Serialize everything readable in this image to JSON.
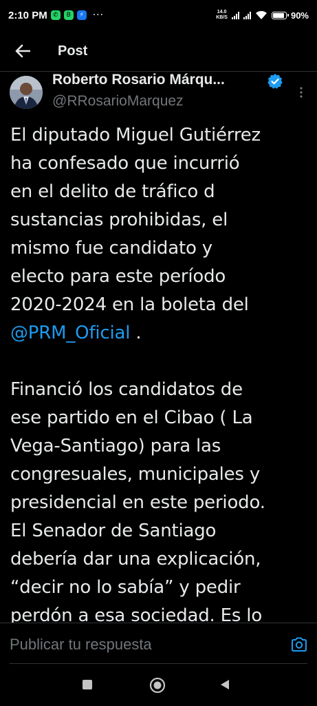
{
  "status_bar": {
    "time": "2:10 PM",
    "more_indicator": "···",
    "net_speed_value": "14.0",
    "net_speed_unit": "KB/S",
    "battery_percent": "90%",
    "battery_level": 0.9
  },
  "header": {
    "title": "Post"
  },
  "author": {
    "name": "Roberto Rosario Márqu...",
    "handle": "@RRosarioMarquez",
    "verified": true
  },
  "tweet": {
    "lines": [
      "El diputado Miguel Gutiérrez",
      "ha confesado que incurrió",
      "en el delito de tráfico d",
      "sustancias prohibidas, el",
      "mismo fue candidato y",
      "electo para este período",
      "2020-2024 en la boleta del"
    ],
    "mention": "@PRM_Oficial",
    "mention_suffix": " .",
    "lines2": [
      "Financió los candidatos de",
      "ese partido en el Cibao ( La",
      "Vega-Santiago) para las",
      "congresuales, municipales y",
      "presidencial en este periodo.",
      "El Senador de Santiago",
      "debería dar una explicación,",
      "“decir no lo sabía” y pedir",
      "perdón a esa sociedad. Es lo"
    ]
  },
  "reply": {
    "placeholder": "Publicar tu respuesta"
  },
  "colors": {
    "background": "#000000",
    "text": "#e7e9ea",
    "secondary": "#71767b",
    "accent": "#1d9bf0"
  },
  "icons": {
    "back": "arrow-left-icon",
    "verified": "verified-badge-icon",
    "more": "more-vertical-icon",
    "camera": "camera-icon",
    "nav_recent": "square-icon",
    "nav_home": "circle-icon",
    "nav_back": "triangle-back-icon"
  }
}
